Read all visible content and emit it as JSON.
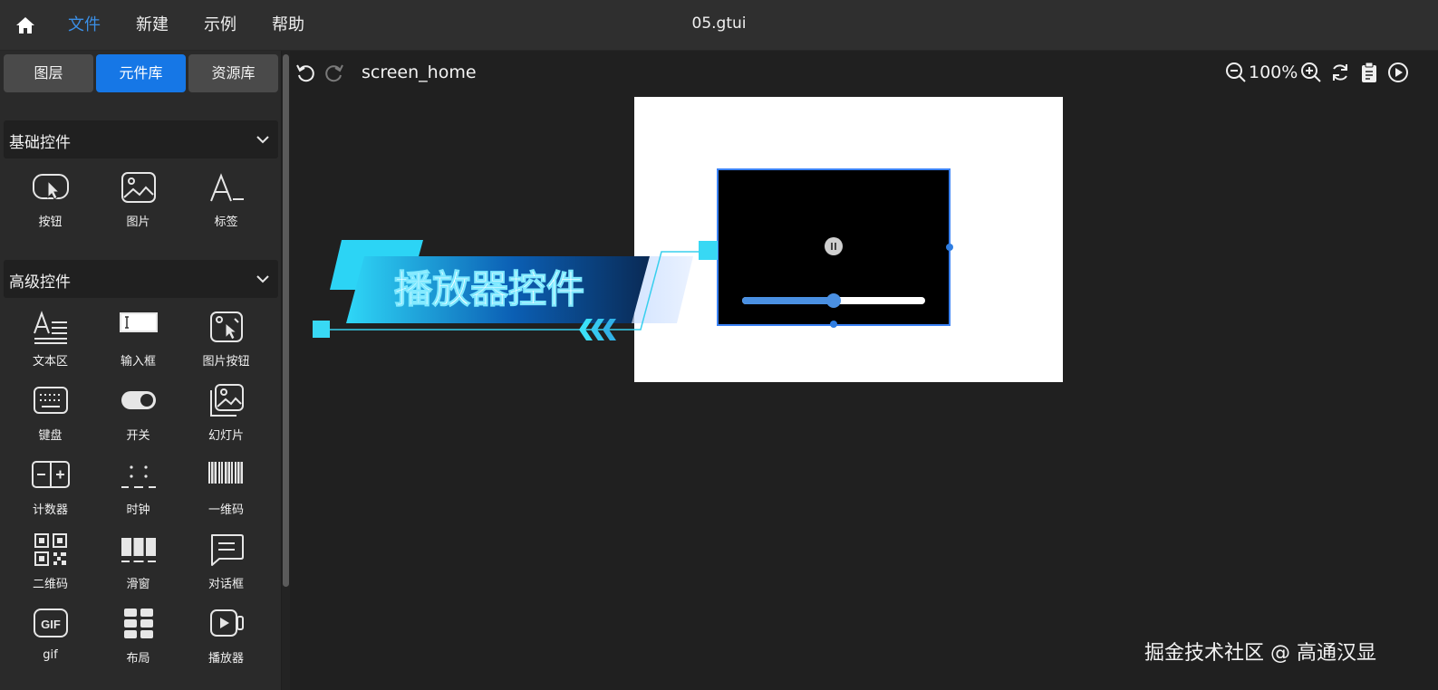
{
  "menubar": {
    "home_icon": "home-icon",
    "items": [
      {
        "label": "文件",
        "active": true
      },
      {
        "label": "新建",
        "active": false
      },
      {
        "label": "示例",
        "active": false
      },
      {
        "label": "帮助",
        "active": false
      }
    ],
    "filename": "05.gtui"
  },
  "left_panel": {
    "tabs": [
      {
        "label": "图层",
        "active": false
      },
      {
        "label": "元件库",
        "active": true
      },
      {
        "label": "资源库",
        "active": false
      }
    ],
    "sections": [
      {
        "title": "基础控件",
        "widgets": [
          {
            "label": "按钮",
            "icon": "button-cursor-icon"
          },
          {
            "label": "图片",
            "icon": "image-icon"
          },
          {
            "label": "标签",
            "icon": "text-label-icon"
          }
        ]
      },
      {
        "title": "高级控件",
        "widgets": [
          {
            "label": "文本区",
            "icon": "text-area-icon"
          },
          {
            "label": "输入框",
            "icon": "input-box-icon"
          },
          {
            "label": "图片按钮",
            "icon": "image-button-icon"
          },
          {
            "label": "键盘",
            "icon": "keyboard-icon"
          },
          {
            "label": "开关",
            "icon": "toggle-switch-icon"
          },
          {
            "label": "幻灯片",
            "icon": "slideshow-icon"
          },
          {
            "label": "计数器",
            "icon": "counter-icon"
          },
          {
            "label": "时钟",
            "icon": "clock-icon"
          },
          {
            "label": "一维码",
            "icon": "barcode-icon"
          },
          {
            "label": "二维码",
            "icon": "qrcode-icon"
          },
          {
            "label": "滑窗",
            "icon": "sliding-window-icon"
          },
          {
            "label": "对话框",
            "icon": "dialog-icon"
          },
          {
            "label": "gif",
            "icon": "gif-icon"
          },
          {
            "label": "布局",
            "icon": "layout-grid-icon"
          },
          {
            "label": "播放器",
            "icon": "player-icon"
          }
        ]
      }
    ]
  },
  "toolbar": {
    "screen_name": "screen_home",
    "zoom": "100%"
  },
  "canvas": {
    "player": {
      "progress": 0.5,
      "accent": "#4a90e2",
      "selection": "#3b82f6"
    }
  },
  "banner": {
    "text": "播放器控件"
  },
  "watermark": "掘金技术社区 @ 高通汉显"
}
